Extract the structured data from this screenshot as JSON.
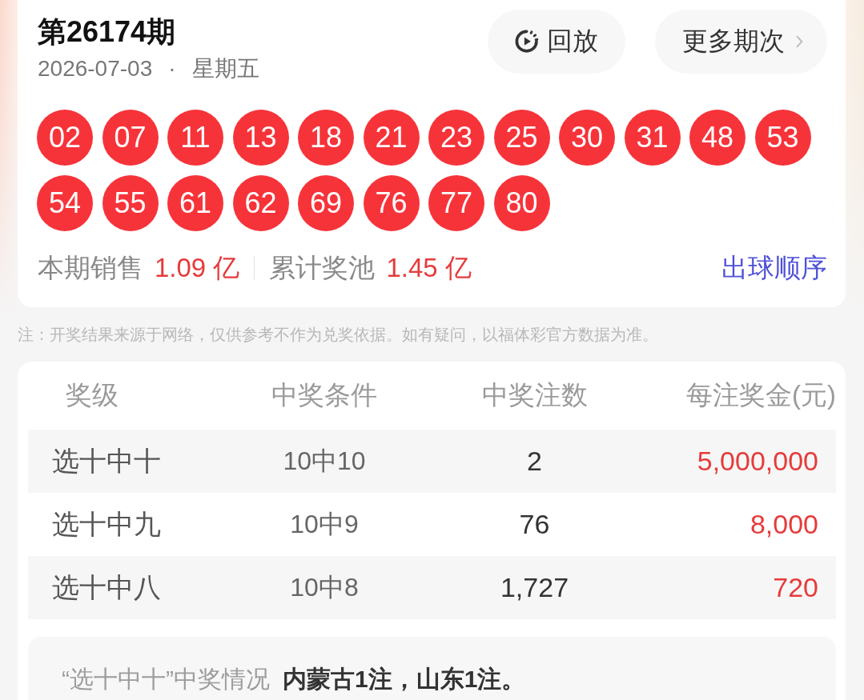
{
  "draw": {
    "issue": "第26174期",
    "date": "2026-07-03",
    "separator": "·",
    "weekday": "星期五"
  },
  "buttons": [
    {
      "kind": "replay",
      "label": "回放"
    },
    {
      "kind": "more",
      "label": "更多期次"
    }
  ],
  "balls": [
    "02",
    "07",
    "11",
    "13",
    "18",
    "21",
    "23",
    "25",
    "30",
    "31",
    "48",
    "53",
    "54",
    "55",
    "61",
    "62",
    "69",
    "76",
    "77",
    "80"
  ],
  "stats": [
    {
      "label": "本期销售",
      "value": "1.09 亿"
    },
    {
      "label": "累计奖池",
      "value": "1.45 亿"
    }
  ],
  "order_link": "出球顺序",
  "note": "注：开奖结果来源于网络，仅供参考不作为兑奖依据。如有疑问，以福体彩官方数据为准。",
  "prize_table": {
    "columns": [
      "奖级",
      "中奖条件",
      "中奖注数",
      "每注奖金(元)"
    ],
    "rows": [
      [
        "选十中十",
        "10中10",
        "2",
        "5,000,000"
      ],
      [
        "选十中九",
        "10中9",
        "76",
        "8,000"
      ],
      [
        "选十中八",
        "10中8",
        "1,727",
        "720"
      ]
    ]
  },
  "winners": {
    "label": "“选十中十”中奖情况",
    "detail": "内蒙古1注，山东1注。"
  }
}
